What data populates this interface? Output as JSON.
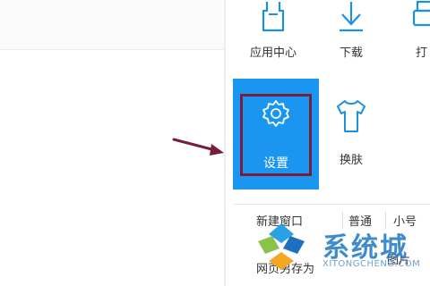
{
  "menu": {
    "top_row": [
      {
        "label": "应用中心",
        "icon": "app-center-icon"
      },
      {
        "label": "下载",
        "icon": "download-icon"
      },
      {
        "label": "打",
        "icon": "print-icon"
      }
    ],
    "settings": {
      "label": "设置",
      "icon": "gear-icon",
      "tile_color": "#1a96f0",
      "highlight_color": "#7a1c3c"
    },
    "skin": {
      "label": "换肤",
      "icon": "shirt-icon"
    },
    "new_window": "新建窗口",
    "zoom_normal": "普通",
    "zoom_small": "小号",
    "save_page_as": "网页另存为",
    "image": "图片"
  },
  "annotation": {
    "arrow_color": "#7a1c3c"
  },
  "watermark": {
    "title": "系统城",
    "url": "XITONGCHENG.COM"
  }
}
